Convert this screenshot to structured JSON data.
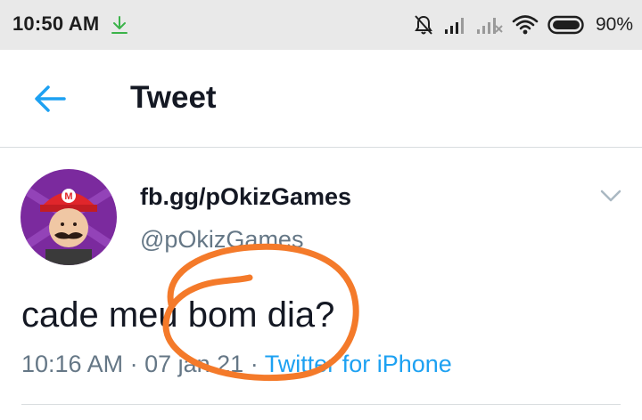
{
  "status_bar": {
    "time": "10:50 AM",
    "battery_percent": "90%",
    "icons": [
      "download-icon",
      "bell-off-icon",
      "signal-icon",
      "signal-no-service-icon",
      "wifi-icon",
      "battery-icon"
    ]
  },
  "app_bar": {
    "title": "Tweet",
    "back_icon": "back-arrow-icon"
  },
  "tweet": {
    "display_name": "fb.gg/pOkizGames",
    "handle": "@pOkizGames",
    "text": "cade meu bom dia?",
    "time": "10:16 AM",
    "separator": " · ",
    "date": "07 jan 21",
    "source": "Twitter for iPhone",
    "menu_icon": "chevron-down-icon"
  },
  "colors": {
    "accent": "#1da1f2",
    "secondary_text": "#657786",
    "primary_text": "#141823",
    "annotation": "#f47a2a",
    "status_bar_bg": "#e9e9e9"
  }
}
